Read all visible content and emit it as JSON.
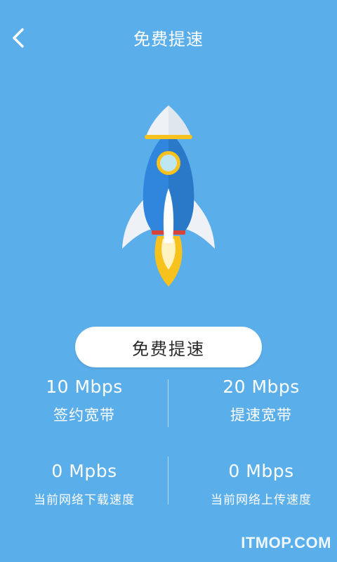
{
  "header": {
    "back_icon": "chevron-left-icon",
    "title": "免费提速"
  },
  "hero": {
    "icon": "rocket-icon"
  },
  "action": {
    "boost_label": "免费提速"
  },
  "stats": {
    "contract_bandwidth": {
      "value": "10 Mbps",
      "label": "签约宽带"
    },
    "boosted_bandwidth": {
      "value": "20 Mbps",
      "label": "提速宽带"
    },
    "download_speed": {
      "value": "0 Mpbs",
      "label": "当前网络下载速度"
    },
    "upload_speed": {
      "value": "0 Mbps",
      "label": "当前网络上传速度"
    }
  },
  "watermark": "ITMOP.COM",
  "colors": {
    "background": "#5aaeea",
    "rocket_blue": "#2f86dc",
    "flame_yellow": "#f7c21d"
  }
}
